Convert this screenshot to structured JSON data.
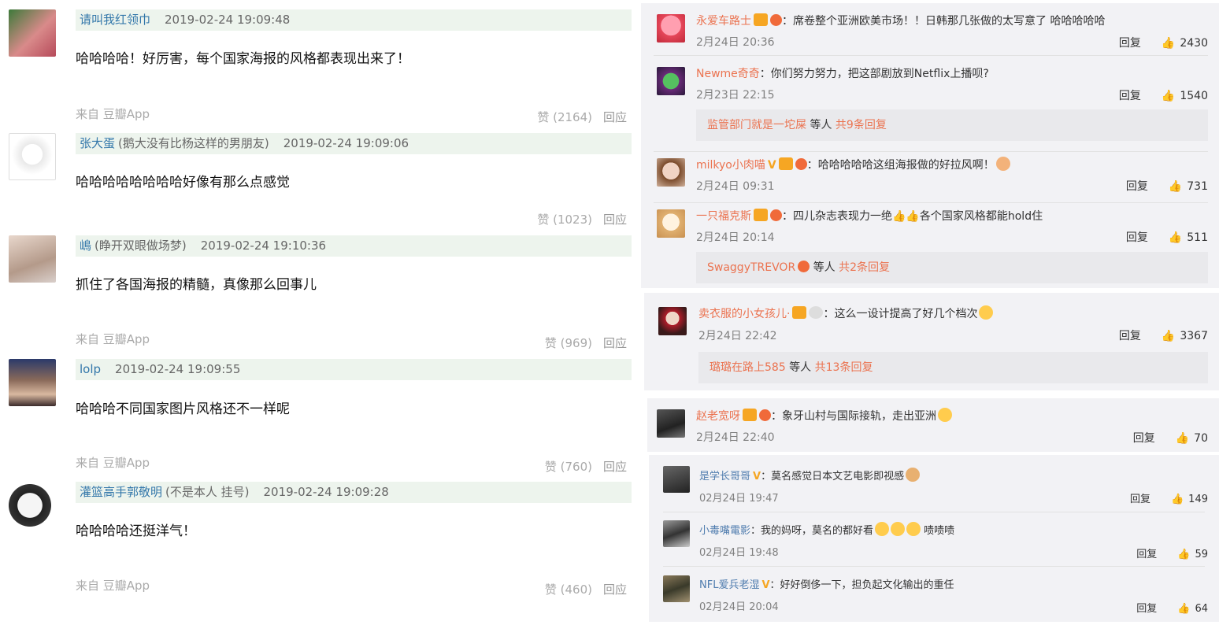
{
  "douban": {
    "comments": [
      {
        "name": "请叫我红领巾",
        "sig": "",
        "time": "2019-02-24 19:09:48",
        "text": "哈哈哈哈！好厉害，每个国家海报的风格都表现出来了！",
        "source": "来自 豆瓣App",
        "votes": "赞 (2164)",
        "reply": "回应"
      },
      {
        "name": "张大蛋",
        "sig": "(鹅大没有比杨这样的男朋友)",
        "time": "2019-02-24 19:09:06",
        "text": "哈哈哈哈哈哈哈哈好像有那么点感觉",
        "source": "",
        "votes": "赞 (1023)",
        "reply": "回应"
      },
      {
        "name": "嶋",
        "sig": "(睁开双眼做场梦)",
        "time": "2019-02-24 19:10:36",
        "text": "抓住了各国海报的精髓，真像那么回事儿",
        "source": "来自 豆瓣App",
        "votes": "赞 (969)",
        "reply": "回应"
      },
      {
        "name": "lolp",
        "sig": "",
        "time": "2019-02-24 19:09:55",
        "text": "哈哈哈不同国家图片风格还不一样呢",
        "source": "来自 豆瓣App",
        "votes": "赞 (760)",
        "reply": "回应"
      },
      {
        "name": "灌篮高手郭敬明",
        "sig": "(不是本人 挂号)",
        "time": "2019-02-24 19:09:28",
        "text": "哈哈哈哈还挺洋气！",
        "source": "来自 豆瓣App",
        "votes": "赞 (460)",
        "reply": "回应"
      }
    ]
  },
  "weibo": {
    "panel1": [
      {
        "name": "永爱车路士",
        "text": "：席卷整个亚洲欧美市场！！日韩那几张做的太写意了 哈哈哈哈哈",
        "time": "2月24日 20:36",
        "reply": "回复",
        "likes": "2430"
      },
      {
        "name": "Newme奇奇",
        "text": "：你们努力努力，把这部剧放到Netflix上播呗?",
        "time": "2月23日 22:15",
        "reply": "回复",
        "likes": "1540",
        "more_user": "监管部门就是一坨屎",
        "more_mid": " 等人 ",
        "more_count": "共9条回复"
      },
      {
        "name": "milkyo小肉喵",
        "text": "：哈哈哈哈哈这组海报做的好拉风啊！",
        "time": "2月24日 09:31",
        "reply": "回复",
        "likes": "731"
      },
      {
        "name": "一只福克斯",
        "text": "：四儿杂志表现力一绝👍👍各个国家风格都能hold住",
        "time": "2月24日 20:14",
        "reply": "回复",
        "likes": "511",
        "more_user": "SwaggyTREVOR",
        "more_mid": " 等人 ",
        "more_count": "共2条回复"
      }
    ],
    "panel2": {
      "name": "卖衣服的小女孩儿·",
      "text": "：这么一设计提高了好几个档次",
      "time": "2月24日 22:42",
      "reply": "回复",
      "likes": "3367",
      "more_user": "璐璐在路上585",
      "more_mid": " 等人 ",
      "more_count": "共13条回复"
    },
    "panel3": {
      "name": "赵老宽呀",
      "text": "：象牙山村与国际接轨，走出亚洲",
      "time": "2月24日 22:40",
      "reply": "回复",
      "likes": "70"
    },
    "panel4": [
      {
        "name": "是学长哥哥",
        "text": "：莫名感觉日本文艺电影即视感",
        "time": "02月24日 19:47",
        "reply": "回复",
        "likes": "149"
      },
      {
        "name": "小毒嘴電影",
        "text": "：我的妈呀，莫名的都好看",
        "tail": " 啧啧啧",
        "time": "02月24日 19:48",
        "reply": "回复",
        "likes": "59"
      },
      {
        "name": "NFL爱兵老湿",
        "text": "：好好倒侈一下，担负起文化输出的重任",
        "time": "02月24日 20:04",
        "reply": "回复",
        "likes": "64"
      }
    ]
  },
  "colors": {
    "douban_header_bg": "#edf4ed",
    "douban_link": "#3377aa",
    "weibo_name": "#eb7350",
    "weibo_bg": "#f2f2f5"
  }
}
